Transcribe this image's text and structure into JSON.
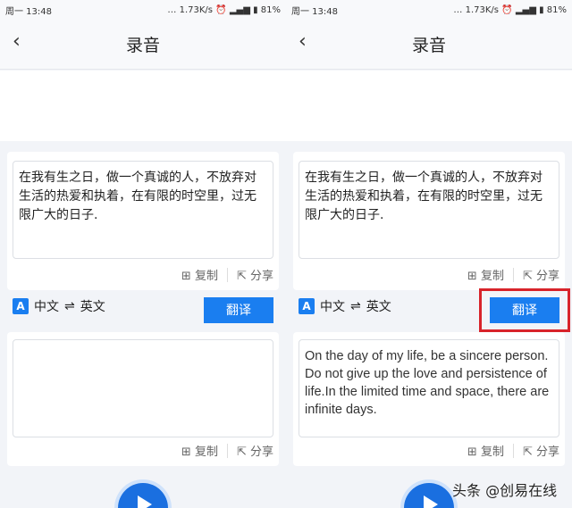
{
  "status": {
    "time": "周一 13:48",
    "speed": "1.73K/s",
    "battery": "81%"
  },
  "header": {
    "title": "录音",
    "back": "‹"
  },
  "source_text": "在我有生之日，做一个真诚的人，不放弃对生活的热爱和执着，在有限的时空里，过无限广大的日子.",
  "actions": {
    "copy": "复制",
    "share": "分享"
  },
  "lang": {
    "from": "中文",
    "swap": "⇌",
    "to": "英文",
    "icon": "A"
  },
  "translate_label": "翻译",
  "panels": [
    {
      "result": ""
    },
    {
      "result": "On the day of my life, be a sincere person. Do not give up the love and persistence of life.In the limited time and space, there are infinite days."
    }
  ],
  "watermark": "头条 @创易在线",
  "colors": {
    "accent": "#1a7ef0",
    "highlight": "#d8232a"
  }
}
